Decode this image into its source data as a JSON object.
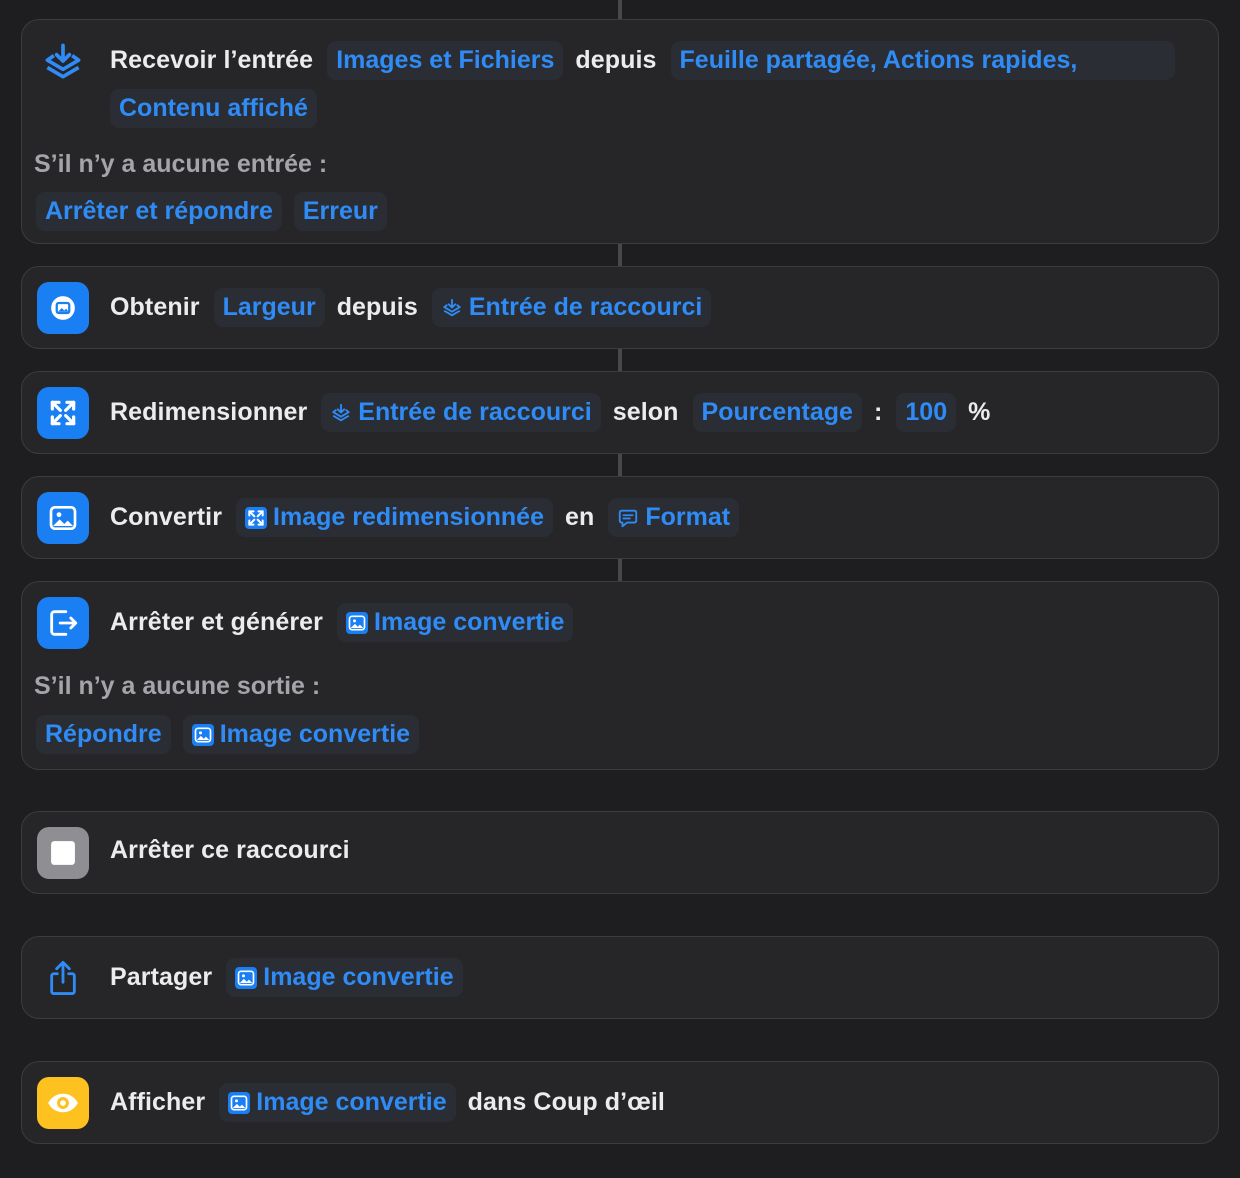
{
  "colors": {
    "background": "#1e1e20",
    "card": "#262628",
    "card_border": "#3c3c40",
    "token_text": "#2f8cf6",
    "action_blue": "#1a7ff3",
    "action_gray": "#8e8e93",
    "action_yellow": "#fdc21f"
  },
  "actions": {
    "receive": {
      "icon": "shortcut-input-icon",
      "verb": "Recevoir l’entrée",
      "types": "Images et Fichiers",
      "from_word": "depuis",
      "sources_line1": "Feuille partagée, Actions rapides,",
      "sources_line2": "Contenu affiché",
      "no_input_label": "S’il n’y a aucune entrée :",
      "no_input_action": "Arrêter et répondre",
      "no_input_value": "Erreur"
    },
    "get": {
      "icon": "image-details-icon",
      "verb": "Obtenir",
      "property": "Largeur",
      "from_word": "depuis",
      "source": "Entrée de raccourci",
      "source_icon": "shortcut-input-icon"
    },
    "resize": {
      "icon": "resize-icon",
      "verb": "Redimensionner",
      "source": "Entrée de raccourci",
      "source_icon": "shortcut-input-icon",
      "by_word": "selon",
      "mode": "Pourcentage",
      "colon": ":",
      "value": "100",
      "unit": "%"
    },
    "convert": {
      "icon": "photo-icon",
      "verb": "Convertir",
      "source": "Image redimensionnée",
      "source_icon": "resize-icon",
      "to_word": "en",
      "format": "Format",
      "format_icon": "speech-bubble-icon"
    },
    "stop_output": {
      "icon": "exit-icon",
      "verb": "Arrêter et générer",
      "output": "Image convertie",
      "output_icon": "photo-icon",
      "no_output_label": "S’il n’y a aucune sortie :",
      "no_output_action": "Répondre",
      "no_output_value": "Image convertie"
    },
    "stop": {
      "icon": "stop-icon",
      "verb": "Arrêter ce raccourci"
    },
    "share": {
      "icon": "share-icon",
      "verb": "Partager",
      "item": "Image convertie",
      "item_icon": "photo-icon"
    },
    "show": {
      "icon": "eye-icon",
      "verb": "Afficher",
      "item": "Image convertie",
      "item_icon": "photo-icon",
      "suffix": "dans Coup d’œil"
    }
  }
}
